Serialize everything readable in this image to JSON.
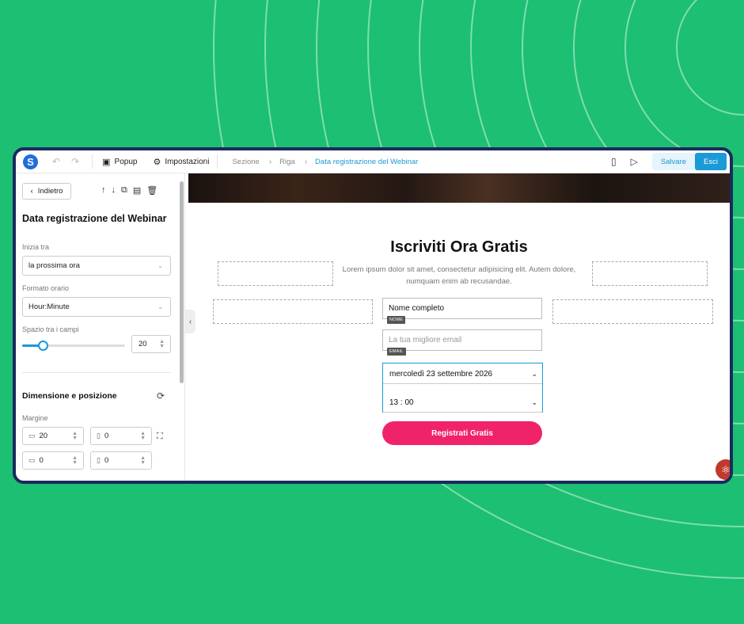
{
  "topbar": {
    "logo": "S",
    "popup_label": "Popup",
    "settings_label": "Impostazioni",
    "breadcrumbs": [
      "Sezione",
      "Riga",
      "Data registrazione del Webinar"
    ],
    "save_label": "Salvare",
    "exit_label": "Esci"
  },
  "panel": {
    "back_label": "Indietro",
    "title": "Data registrazione del Webinar",
    "start_label": "Inizia tra",
    "start_value": "la prossima ora",
    "time_format_label": "Formato orario",
    "time_format_value": "Hour:Minute",
    "spacing_label": "Spazio tra i campi",
    "spacing_value": "20",
    "spacing_fraction": 0.2,
    "size_section_title": "Dimensione e posizione",
    "margin_label": "Margine",
    "margin_top": "20",
    "margin_right": "0",
    "margin_bottom": "0",
    "margin_left": "0"
  },
  "form": {
    "title": "Iscriviti Ora Gratis",
    "description": "Lorem ipsum dolor sit amet, consectetur adipisicing elit. Autem dolore, numquam enim ab recusandae.",
    "name_value": "Nome completo",
    "name_tag": "NOME",
    "email_placeholder": "La tua migliore email",
    "email_tag": "EMAIL",
    "date_value": "mercoledì 23 settembre 2026",
    "time_value": "13 : 00",
    "submit_label": "Registrati Gratis"
  },
  "colors": {
    "background": "#1dbf73",
    "accent": "#1a9ad6",
    "submit": "#f0226a",
    "frame": "#1a2a5e"
  }
}
